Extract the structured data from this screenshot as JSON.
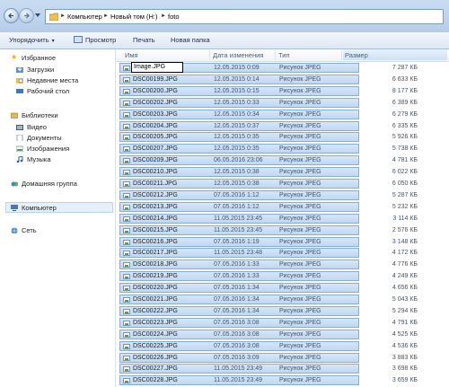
{
  "address": {
    "crumbs": [
      "Компьютер",
      "Новый том (H:)",
      "foto"
    ]
  },
  "toolbar": {
    "organize": "Упорядочить",
    "preview": "Просмотр",
    "print": "Печать",
    "new_folder": "Новая папка"
  },
  "navpane": {
    "favorites": "Избранное",
    "downloads": "Загрузки",
    "recent": "Недавние места",
    "desktop": "Рабочий стол",
    "libraries": "Библиотеки",
    "video": "Видео",
    "documents": "Документы",
    "images": "Изображения",
    "music": "Музыка",
    "homegroup": "Домашняя группа",
    "computer": "Компьютер",
    "network": "Сеть"
  },
  "columns": {
    "name": "Имя",
    "date": "Дата изменения",
    "type": "Тип",
    "size": "Размер"
  },
  "rename_value": "Image.JPG",
  "files": [
    {
      "name": "Image.JPG",
      "date": "12.05.2015 0:09",
      "type": "Рисунок JPEG",
      "size": "7 287 КБ"
    },
    {
      "name": "DSC00199.JPG",
      "date": "12.05.2015 0:14",
      "type": "Рисунок JPEG",
      "size": "6 633 КБ"
    },
    {
      "name": "DSC00200.JPG",
      "date": "12.05.2015 0:15",
      "type": "Рисунок JPEG",
      "size": "8 177 КБ"
    },
    {
      "name": "DSC00202.JPG",
      "date": "12.05.2015 0:33",
      "type": "Рисунок JPEG",
      "size": "6 389 КБ"
    },
    {
      "name": "DSC00203.JPG",
      "date": "12.05.2015 0:34",
      "type": "Рисунок JPEG",
      "size": "6 279 КБ"
    },
    {
      "name": "DSC00204.JPG",
      "date": "12.05.2015 0:37",
      "type": "Рисунок JPEG",
      "size": "6 335 КБ"
    },
    {
      "name": "DSC00205.JPG",
      "date": "12.05.2015 0:35",
      "type": "Рисунок JPEG",
      "size": "5 926 КБ"
    },
    {
      "name": "DSC00207.JPG",
      "date": "12.05.2015 0:35",
      "type": "Рисунок JPEG",
      "size": "5 738 КБ"
    },
    {
      "name": "DSC00209.JPG",
      "date": "06.05.2016 23:06",
      "type": "Рисунок JPEG",
      "size": "4 781 КБ"
    },
    {
      "name": "DSC00210.JPG",
      "date": "12.05.2015 0:38",
      "type": "Рисунок JPEG",
      "size": "6 022 КБ"
    },
    {
      "name": "DSC00211.JPG",
      "date": "12.05.2015 0:38",
      "type": "Рисунок JPEG",
      "size": "6 050 КБ"
    },
    {
      "name": "DSC00212.JPG",
      "date": "07.05.2016 1:12",
      "type": "Рисунок JPEG",
      "size": "5 287 КБ"
    },
    {
      "name": "DSC00213.JPG",
      "date": "07.05.2016 1:12",
      "type": "Рисунок JPEG",
      "size": "5 232 КБ"
    },
    {
      "name": "DSC00214.JPG",
      "date": "11.05.2015 23:45",
      "type": "Рисунок JPEG",
      "size": "3 114 КБ"
    },
    {
      "name": "DSC00215.JPG",
      "date": "11.05.2015 23:45",
      "type": "Рисунок JPEG",
      "size": "2 576 КБ"
    },
    {
      "name": "DSC00216.JPG",
      "date": "07.05.2016 1:19",
      "type": "Рисунок JPEG",
      "size": "3 148 КБ"
    },
    {
      "name": "DSC00217.JPG",
      "date": "11.05.2015 23:48",
      "type": "Рисунок JPEG",
      "size": "4 172 КБ"
    },
    {
      "name": "DSC00218.JPG",
      "date": "07.05.2016 1:33",
      "type": "Рисунок JPEG",
      "size": "4 776 КБ"
    },
    {
      "name": "DSC00219.JPG",
      "date": "07.05.2016 1:33",
      "type": "Рисунок JPEG",
      "size": "4 249 КБ"
    },
    {
      "name": "DSC00220.JPG",
      "date": "07.05.2016 1:34",
      "type": "Рисунок JPEG",
      "size": "4 656 КБ"
    },
    {
      "name": "DSC00221.JPG",
      "date": "07.05.2016 1:34",
      "type": "Рисунок JPEG",
      "size": "5 043 КБ"
    },
    {
      "name": "DSC00222.JPG",
      "date": "07.05.2016 1:34",
      "type": "Рисунок JPEG",
      "size": "5 294 КБ"
    },
    {
      "name": "DSC00223.JPG",
      "date": "07.05.2016 3:08",
      "type": "Рисунок JPEG",
      "size": "4 791 КБ"
    },
    {
      "name": "DSC00224.JPG",
      "date": "07.05.2016 3:08",
      "type": "Рисунок JPEG",
      "size": "4 525 КБ"
    },
    {
      "name": "DSC00225.JPG",
      "date": "07.05.2016 3:08",
      "type": "Рисунок JPEG",
      "size": "4 536 КБ"
    },
    {
      "name": "DSC00226.JPG",
      "date": "07.05.2016 3:09",
      "type": "Рисунок JPEG",
      "size": "3 883 КБ"
    },
    {
      "name": "DSC00227.JPG",
      "date": "11.05.2015 23:49",
      "type": "Рисунок JPEG",
      "size": "3 698 КБ"
    },
    {
      "name": "DSC00228.JPG",
      "date": "11.05.2015 23:49",
      "type": "Рисунок JPEG",
      "size": "3 659 КБ"
    }
  ]
}
